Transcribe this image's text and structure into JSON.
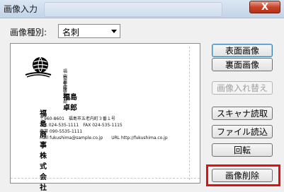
{
  "window": {
    "title": "画像入力",
    "close_label": "X"
  },
  "image_type": {
    "label": "画像種別:",
    "value": "名刺"
  },
  "card": {
    "branch": "福島支店",
    "department": "内部監査部",
    "role": "支店長",
    "person_name": "福島　卓郎",
    "company": "福島商事株式会社",
    "address": "〒960-8601　福島市五老内町３番１号",
    "tel_fax": "TEL 024-535-1111　FAX 024-535-1115",
    "mobile": "携帯 090-5535-1111",
    "mail_url": "Mail fukushima@sample.co.jp　　URL http://fukushima.co.jp"
  },
  "buttons": {
    "front": "表面画像",
    "back": "裏面画像",
    "swap": "画像入れ替え",
    "scan": "スキャナ読取",
    "file": "ファイル読込",
    "rotate": "回転",
    "delete": "画像削除"
  },
  "colors": {
    "highlight": "#e01010",
    "close": "#c7452b"
  }
}
